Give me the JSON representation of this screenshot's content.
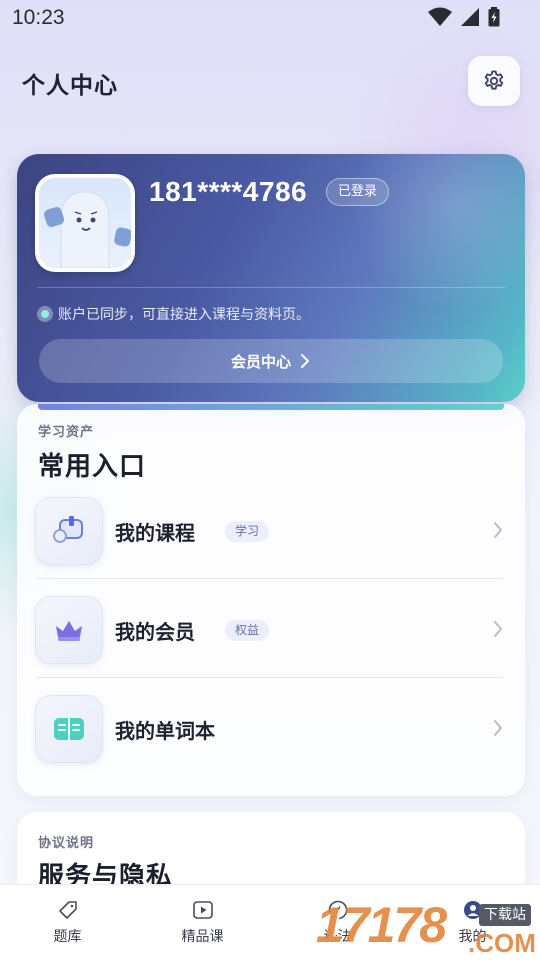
{
  "status_bar": {
    "time": "10:23"
  },
  "header": {
    "title": "个人中心",
    "settings_icon": "gear-icon"
  },
  "profile": {
    "phone": "181****4786",
    "login_status": "已登录",
    "sync_text": "账户已同步，可直接进入课程与资料页。",
    "member_button": "会员中心"
  },
  "shortcuts": {
    "kicker": "学习资产",
    "title": "常用入口",
    "items": [
      {
        "label": "我的课程",
        "tag": "学习",
        "icon": "course-icon"
      },
      {
        "label": "我的会员",
        "tag": "权益",
        "icon": "crown-icon"
      },
      {
        "label": "我的单词本",
        "tag": "",
        "icon": "book-icon"
      }
    ]
  },
  "policy": {
    "kicker": "协议说明",
    "title": "服务与隐私"
  },
  "bottom_nav": [
    {
      "label": "题库",
      "icon": "tag-icon"
    },
    {
      "label": "精品课",
      "icon": "play-icon"
    },
    {
      "label": "语法",
      "icon": "compass-icon"
    },
    {
      "label": "我的",
      "icon": "user-icon"
    }
  ],
  "watermark": {
    "number": "17178",
    "domain": ".COM",
    "tag": "下载站"
  },
  "colors": {
    "card_gradient_start": "#3d4482",
    "card_gradient_end": "#5bd0c6",
    "accent_purple": "#7483e8",
    "accent_teal": "#5fd2cc"
  }
}
